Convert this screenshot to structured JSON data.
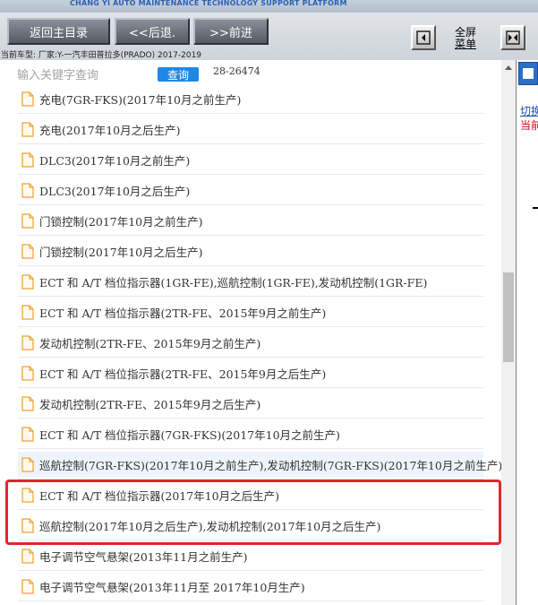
{
  "banner": {
    "subtitle": "CHANG YI AUTO MAINTENANCE TECHNOLOGY SUPPORT PLATFORM"
  },
  "toolbar": {
    "home_label": "返回主目录",
    "back_label": "<<后退.",
    "forward_label": ">>前进",
    "fullscreen_line1": "全屏",
    "fullscreen_line2": "菜单",
    "vehicle_info": "当前车型:  厂家:Y-一汽丰田普拉多(PRADO) 2017-2019"
  },
  "search": {
    "placeholder": "输入关键字查询",
    "button_label": "查询",
    "doc_code": "28-26474"
  },
  "items": [
    {
      "label": "充电(7GR-FKS)(2017年10月之前生产)"
    },
    {
      "label": "充电(2017年10月之后生产)"
    },
    {
      "label": "DLC3(2017年10月之前生产)"
    },
    {
      "label": "DLC3(2017年10月之后生产)"
    },
    {
      "label": "门锁控制(2017年10月之前生产)"
    },
    {
      "label": "门锁控制(2017年10月之后生产)"
    },
    {
      "label": "ECT 和 A/T 档位指示器(1GR-FE),巡航控制(1GR-FE),发动机控制(1GR-FE)"
    },
    {
      "label": "ECT 和 A/T 档位指示器(2TR-FE、2015年9月之前生产)"
    },
    {
      "label": "发动机控制(2TR-FE、2015年9月之前生产)"
    },
    {
      "label": "ECT 和 A/T 档位指示器(2TR-FE、2015年9月之后生产)"
    },
    {
      "label": "发动机控制(2TR-FE、2015年9月之后生产)"
    },
    {
      "label": "ECT 和 A/T 档位指示器(7GR-FKS)(2017年10月之前生产)"
    },
    {
      "label": "巡航控制(7GR-FKS)(2017年10月之前生产),发动机控制(7GR-FKS)(2017年10月之前生产)",
      "selected": true
    },
    {
      "label": "ECT 和 A/T 档位指示器(2017年10月之后生产)"
    },
    {
      "label": "巡航控制(2017年10月之后生产),发动机控制(2017年10月之后生产)"
    },
    {
      "label": "电子调节空气悬架(2013年11月之前生产)"
    },
    {
      "label": "电子调节空气悬架(2013年11月至 2017年10月生产)"
    }
  ],
  "right_panel": {
    "switch_label": "切换",
    "current_label": "当前"
  },
  "colors": {
    "accent_blue": "#1e88e5",
    "highlight_red": "#e0262a",
    "file_icon": "#f0a030"
  },
  "icons": {
    "file": "document-icon",
    "collapse_left": "panel-left-icon",
    "collapse_right": "panel-right-icon"
  }
}
